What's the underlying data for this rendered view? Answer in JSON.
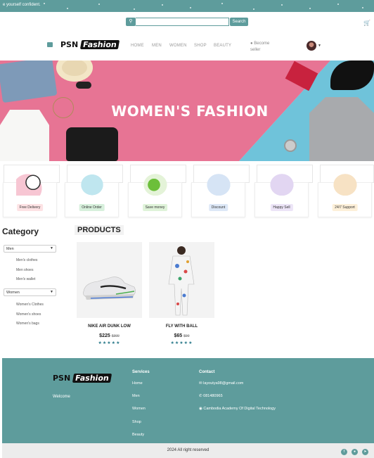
{
  "topbar": {
    "message": "e yourself confident."
  },
  "search": {
    "placeholder": "",
    "button_label": "Search",
    "icon": "search-icon"
  },
  "header": {
    "cart_icon": "cart-icon",
    "logo_left": "PSN",
    "logo_right": "Fashion",
    "nav": [
      "HOME",
      "MEN",
      "WOMEN",
      "SHOP",
      "BEAUTY"
    ],
    "become_seller": "Become seller",
    "user_icon": "user-icon"
  },
  "hero": {
    "title": "WOMEN'S FASHION"
  },
  "features": [
    {
      "label": "Free Delivery",
      "tag_color": "#fde2e4"
    },
    {
      "label": "Online Order",
      "tag_color": "#d7f0dc"
    },
    {
      "label": "Save money",
      "tag_color": "#dff3d9"
    },
    {
      "label": "Discount",
      "tag_color": "#dde8f7"
    },
    {
      "label": "Happy Sell",
      "tag_color": "#ece4f7"
    },
    {
      "label": "24/7 Support",
      "tag_color": "#fdf0d9"
    }
  ],
  "category": {
    "title": "Category",
    "groups": [
      {
        "name": "Men",
        "items": [
          "Men's clothes",
          "Men shoes",
          "Men's wallet"
        ]
      },
      {
        "name": "Women",
        "items": [
          "Women's Clothes",
          "Women's shoes",
          "Women's bags"
        ]
      }
    ]
  },
  "products": {
    "title": "PRODUCTS",
    "items": [
      {
        "name": "NIKE AIR DUNK LOW",
        "price": "$225",
        "old_price": "$300",
        "stars": "★★★★★"
      },
      {
        "name": "FLY WITH BALL",
        "price": "$65",
        "old_price": "$90",
        "stars": "★★★★★"
      }
    ]
  },
  "footer": {
    "welcome": "Welcome",
    "services_title": "Services",
    "services": [
      "Home",
      "Men",
      "Women",
      "Shop",
      "Beauty"
    ],
    "contact_title": "Contact",
    "email": "layoutya98@gmail.com",
    "phone": "081480965",
    "address": "Cambodia Academy Of Digital Technology",
    "copyright": "2024 All right reserved",
    "social": [
      "facebook-icon",
      "messenger-icon",
      "telegram-icon"
    ]
  },
  "colors": {
    "accent": "#5e9c9c",
    "hero_pink": "#e77494",
    "hero_blue": "#6fc3da"
  }
}
